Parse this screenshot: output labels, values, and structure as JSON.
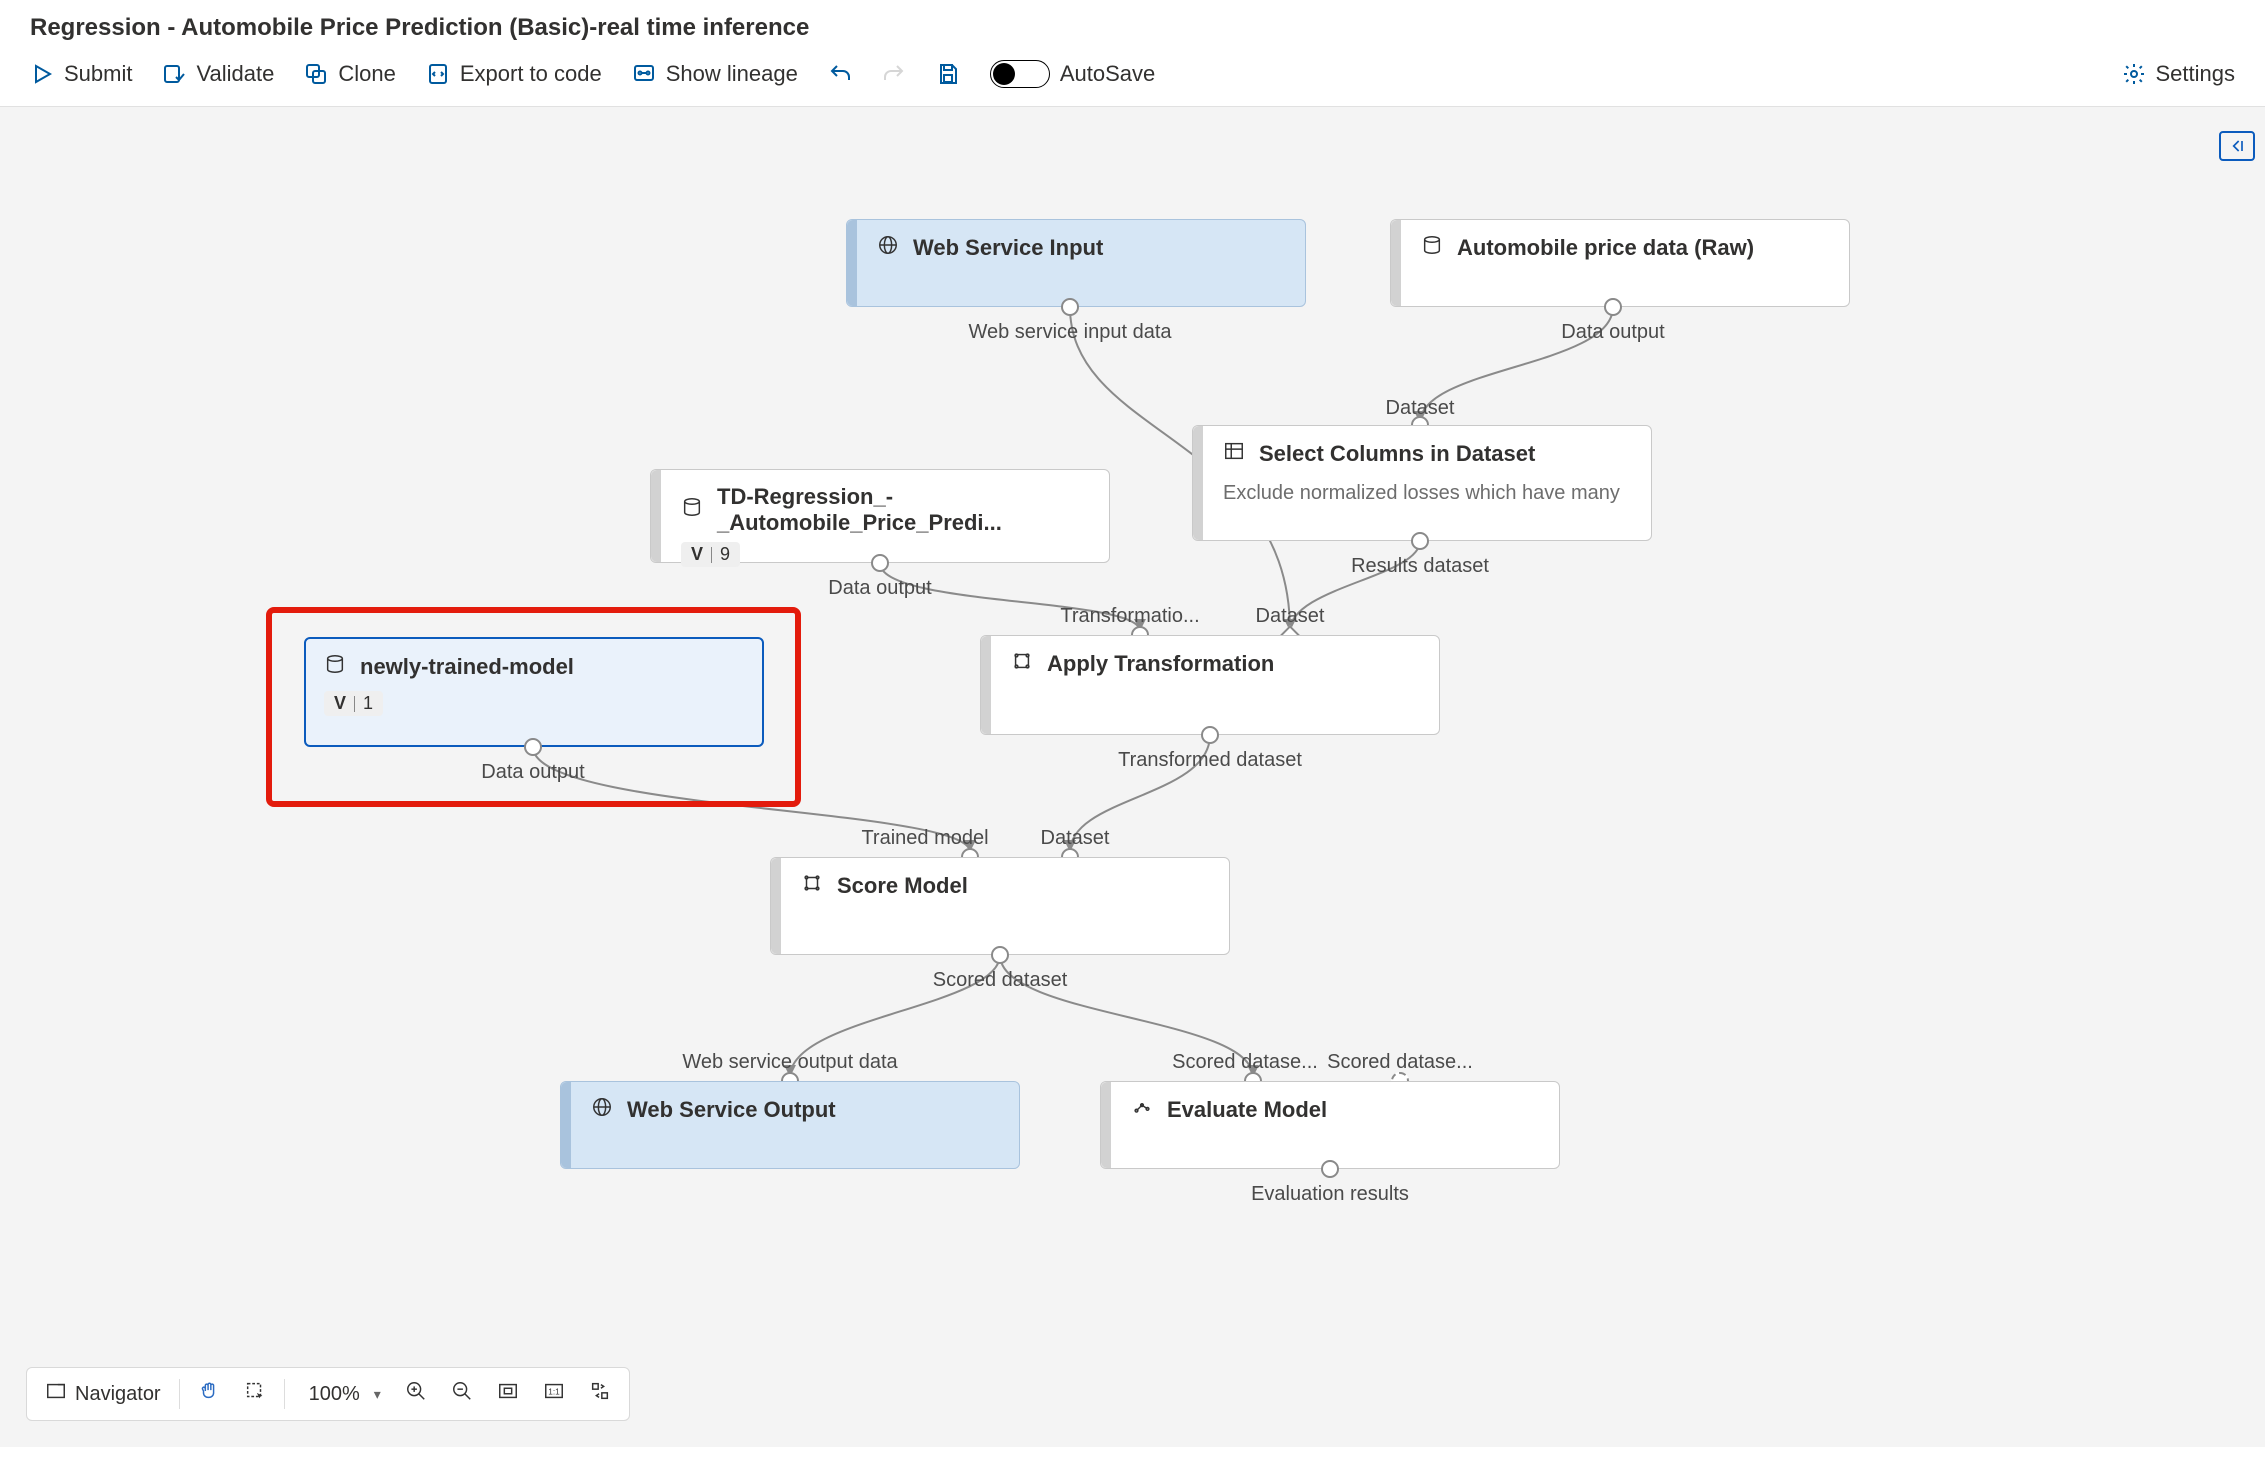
{
  "header": {
    "title": "Regression - Automobile Price Prediction (Basic)-real time inference"
  },
  "toolbar": {
    "submit": "Submit",
    "validate": "Validate",
    "clone": "Clone",
    "export": "Export to code",
    "lineage": "Show lineage",
    "autosave": "AutoSave",
    "autosave_on": false,
    "settings": "Settings"
  },
  "nodes": {
    "web_input": {
      "title": "Web Service Input",
      "out_label": "Web service input data"
    },
    "raw_data": {
      "title": "Automobile price data (Raw)",
      "out_label": "Data output"
    },
    "select_cols": {
      "title": "Select Columns in Dataset",
      "subtitle": "Exclude normalized losses which have many",
      "in_label": "Dataset",
      "out_label": "Results dataset"
    },
    "td_model": {
      "title": "TD-Regression_-_Automobile_Price_Predi...",
      "version": "9",
      "out_label": "Data output"
    },
    "new_model": {
      "title": "newly-trained-model",
      "version": "1",
      "out_label": "Data output"
    },
    "apply_tx": {
      "title": "Apply Transformation",
      "in1_label": "Transformatio...",
      "in2_label": "Dataset",
      "out_label": "Transformed dataset"
    },
    "score": {
      "title": "Score Model",
      "in1_label": "Trained model",
      "in2_label": "Dataset",
      "out_label": "Scored dataset"
    },
    "web_output": {
      "title": "Web Service Output",
      "in_label": "Web service output data"
    },
    "evaluate": {
      "title": "Evaluate Model",
      "in1_label": "Scored datase...",
      "in2_label": "Scored datase...",
      "out_label": "Evaluation results"
    }
  },
  "bottom": {
    "navigator": "Navigator",
    "zoom": "100%"
  },
  "version_label": "V"
}
